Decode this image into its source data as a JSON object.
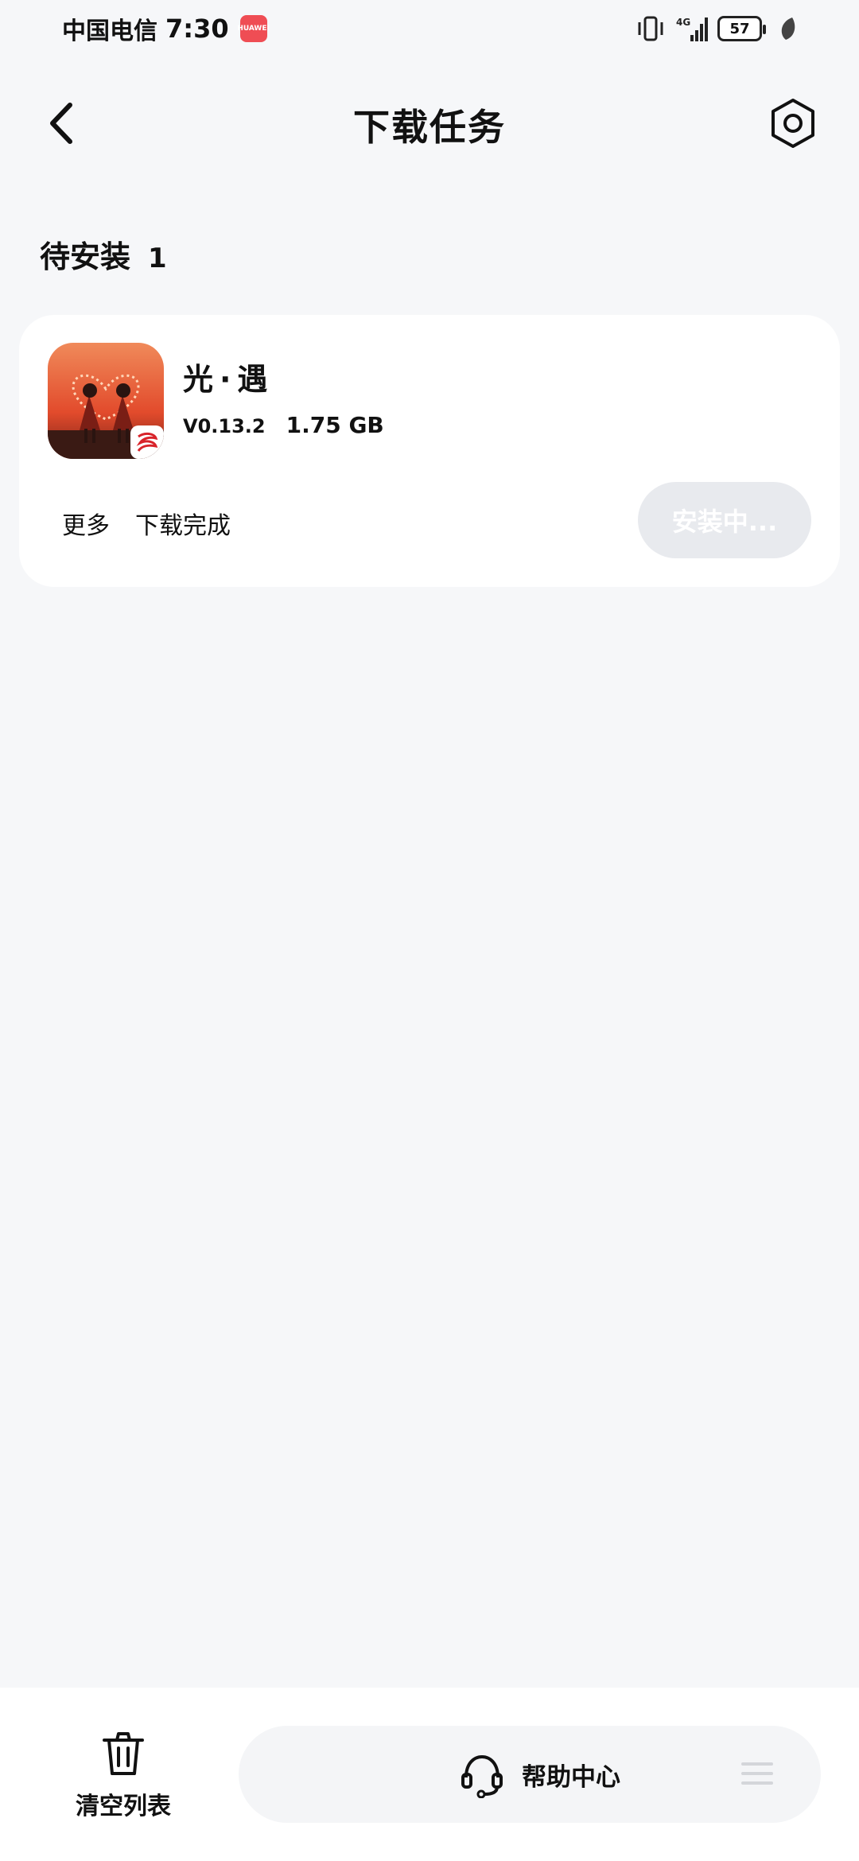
{
  "status_bar": {
    "carrier": "中国电信",
    "time": "7:30",
    "app_badge_text": "HUAWEI",
    "network": "4G",
    "battery": "57"
  },
  "header": {
    "title": "下载任务",
    "back_icon": "chevron-left-icon",
    "settings_icon": "hexagon-settings-icon"
  },
  "section": {
    "title": "待安装",
    "count": "1"
  },
  "task": {
    "app_name": "光·遇",
    "version": "V0.13.2",
    "size": "1.75 GB",
    "more_label": "更多",
    "status": "下载完成",
    "install_label": "安装中..."
  },
  "bottom_bar": {
    "clear_label": "清空列表",
    "help_label": "帮助中心",
    "clear_icon": "trash-icon",
    "help_icon": "headset-icon",
    "menu_icon": "menu-icon"
  },
  "colors": {
    "background": "#f6f7f9",
    "card": "#ffffff",
    "install_disabled": "#e8eaee",
    "badge_red": "#ef4d54"
  }
}
